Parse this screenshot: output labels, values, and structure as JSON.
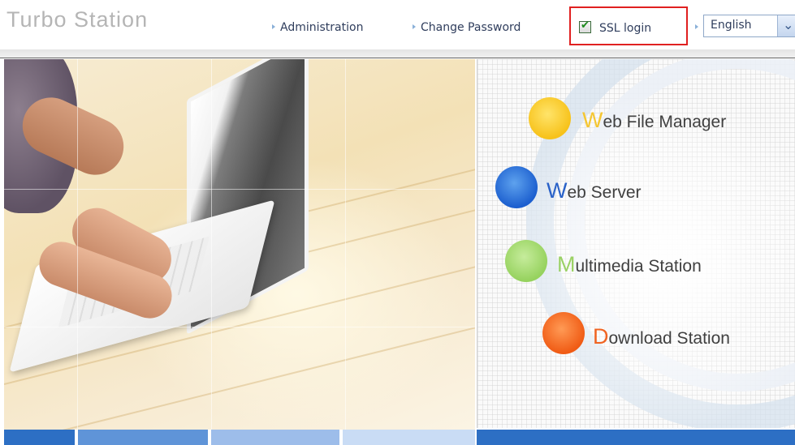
{
  "header": {
    "brand": "Turbo Station",
    "nav": {
      "administration": "Administration",
      "change_password": "Change Password"
    },
    "ssl": {
      "label": "SSL login",
      "checked": true,
      "check_glyph": "✔"
    },
    "language": {
      "selected": "English",
      "dropdown_glyph": "⌄"
    }
  },
  "menu": {
    "web_file_manager": {
      "cap": "W",
      "rest": "eb File Manager",
      "ball_color": "#f7c21a",
      "icon": "yellow-ball-icon"
    },
    "web_server": {
      "cap": "W",
      "rest": "eb Server",
      "ball_color": "#1c5fcf",
      "icon": "blue-ball-icon"
    },
    "multimedia_station": {
      "cap": "M",
      "rest": "ultimedia Station",
      "ball_color": "#96d25e",
      "icon": "green-ball-icon"
    },
    "download_station": {
      "cap": "D",
      "rest": "ownload Station",
      "ball_color": "#f05b14",
      "icon": "orange-ball-icon"
    }
  },
  "colors": {
    "ssl_highlight_border": "#e02020",
    "nav_text": "#2f3d5c",
    "bottom_strip": [
      "#2d6fc4",
      "#5f94d8",
      "#9dbdea",
      "#c9dcf5",
      "#2d6fc4"
    ]
  }
}
